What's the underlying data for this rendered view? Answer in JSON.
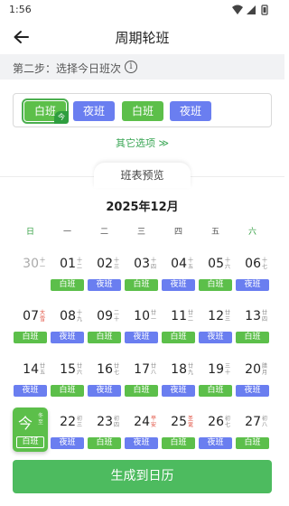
{
  "status": {
    "time": "1:56"
  },
  "header": {
    "title": "周期轮班"
  },
  "step": {
    "text": "第二步：选择今日班次",
    "info_icon": "info-icon"
  },
  "shifts": [
    {
      "label": "白班",
      "color": "#5cbf4a",
      "selected": true,
      "tag": "今"
    },
    {
      "label": "夜班",
      "color": "#6a7ef0"
    },
    {
      "label": "白班",
      "color": "#5cbf4a"
    },
    {
      "label": "夜班",
      "color": "#6a7ef0"
    }
  ],
  "more_options": "其它选项 ≫",
  "preview": {
    "tab": "班表预览",
    "month": "2025年12月"
  },
  "weekdays": [
    "日",
    "一",
    "二",
    "三",
    "四",
    "五",
    "六"
  ],
  "weeks": [
    [
      {
        "day": "30",
        "lunar": "十一",
        "faded": true
      },
      {
        "day": "01",
        "lunar": "十二",
        "shift": "白班"
      },
      {
        "day": "02",
        "lunar": "十三",
        "shift": "夜班"
      },
      {
        "day": "03",
        "lunar": "十四",
        "shift": "白班"
      },
      {
        "day": "04",
        "lunar": "十五",
        "shift": "夜班"
      },
      {
        "day": "05",
        "lunar": "十六",
        "shift": "白班"
      },
      {
        "day": "06",
        "lunar": "十七",
        "shift": "夜班"
      }
    ],
    [
      {
        "day": "07",
        "lunar": "大雪",
        "lunar_red": true,
        "shift": "白班"
      },
      {
        "day": "08",
        "lunar": "十九",
        "shift": "夜班"
      },
      {
        "day": "09",
        "lunar": "二十",
        "shift": "白班"
      },
      {
        "day": "10",
        "lunar": "廿一",
        "shift": "夜班"
      },
      {
        "day": "11",
        "lunar": "廿二",
        "shift": "白班"
      },
      {
        "day": "12",
        "lunar": "廿三",
        "shift": "夜班"
      },
      {
        "day": "13",
        "lunar": "廿四",
        "shift": "白班"
      }
    ],
    [
      {
        "day": "14",
        "lunar": "廿五",
        "shift": "夜班"
      },
      {
        "day": "15",
        "lunar": "廿六",
        "shift": "白班"
      },
      {
        "day": "16",
        "lunar": "廿七",
        "shift": "夜班"
      },
      {
        "day": "17",
        "lunar": "廿八",
        "shift": "白班"
      },
      {
        "day": "18",
        "lunar": "廿九",
        "shift": "夜班"
      },
      {
        "day": "19",
        "lunar": "三十",
        "shift": "白班"
      },
      {
        "day": "20",
        "lunar": "腊月",
        "shift": "夜班"
      }
    ],
    [
      {
        "day": "今",
        "lunar": "冬至",
        "shift": "白班",
        "today": true
      },
      {
        "day": "22",
        "lunar": "初三",
        "shift": "夜班"
      },
      {
        "day": "23",
        "lunar": "初四",
        "shift": "白班"
      },
      {
        "day": "24",
        "lunar": "平安",
        "lunar_red": true,
        "shift": "夜班"
      },
      {
        "day": "25",
        "lunar": "圣诞",
        "lunar_red": true,
        "shift": "白班"
      },
      {
        "day": "26",
        "lunar": "初七",
        "shift": "夜班"
      },
      {
        "day": "27",
        "lunar": "初八",
        "shift": "白班"
      }
    ]
  ],
  "colors": {
    "day_shift": "#5cbf4a",
    "night_shift": "#6a7ef0",
    "accent": "#4dbb5f"
  },
  "generate_button": "生成到日历"
}
